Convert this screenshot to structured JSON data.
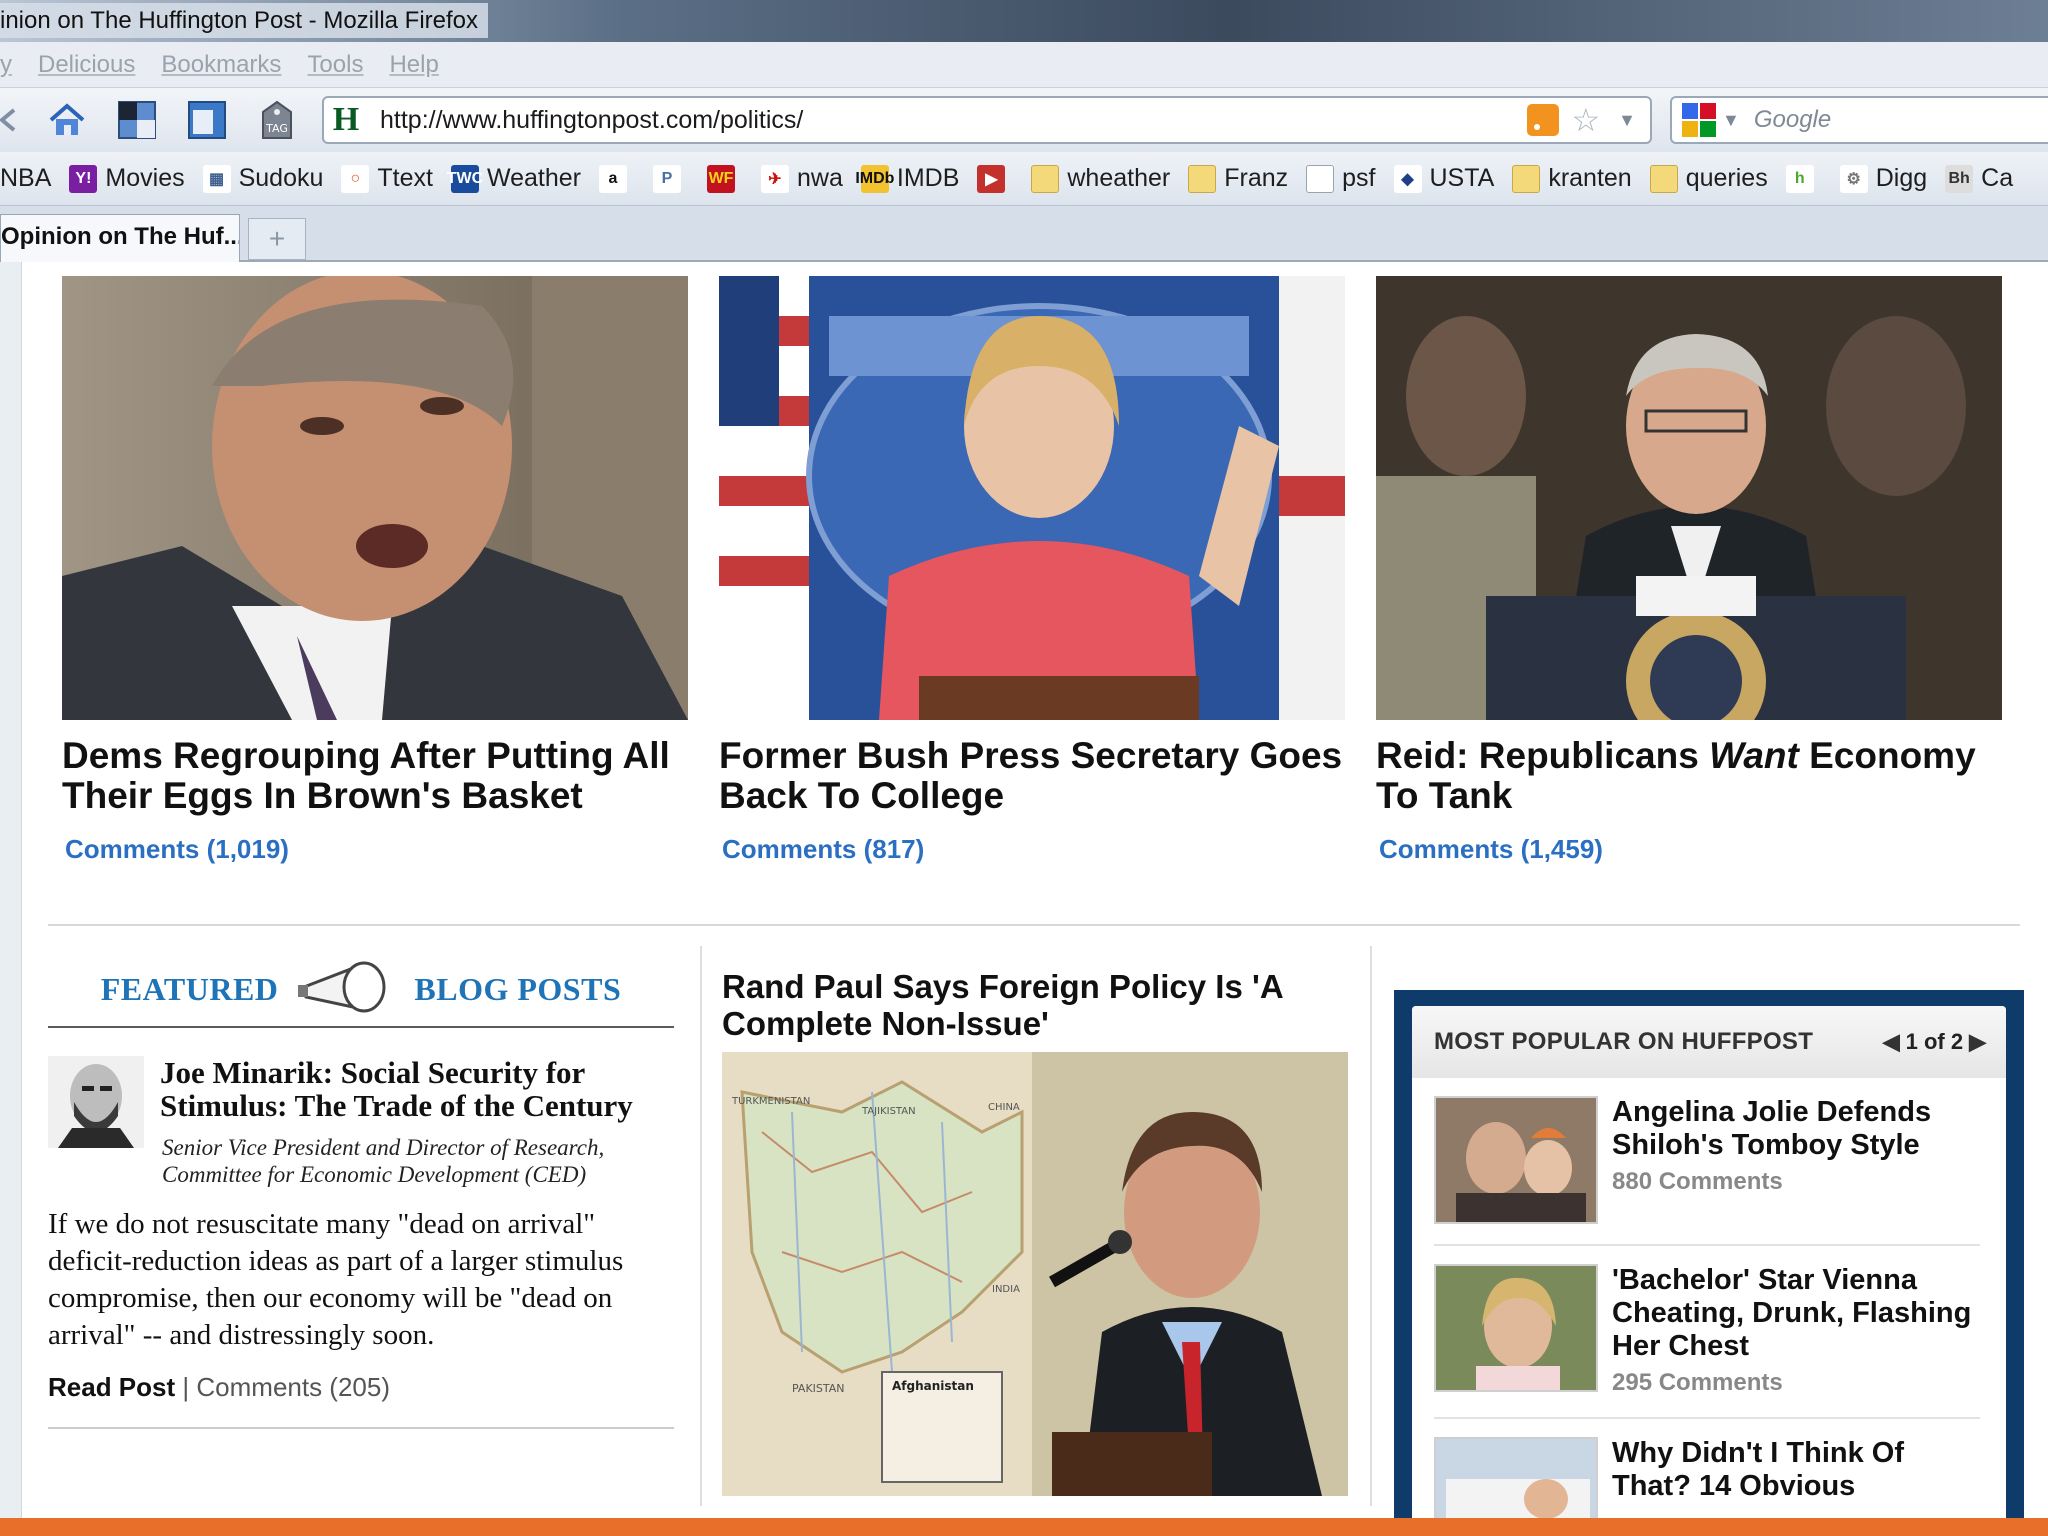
{
  "window": {
    "title": "inion on The Huffington Post - Mozilla Firefox"
  },
  "menu": [
    "y",
    "Delicious",
    "Bookmarks",
    "Tools",
    "Help"
  ],
  "nav": {
    "url": "http://www.huffingtonpost.com/politics/",
    "site_icon": "H",
    "search_placeholder": "Google",
    "icons": [
      "back-arrow-icon",
      "home-icon",
      "screen-icon",
      "window-icon",
      "tag-icon"
    ]
  },
  "bookmarks": [
    {
      "label": "NBA",
      "icon": "nba-icon"
    },
    {
      "label": "Movies",
      "icon": "yahoo-icon",
      "glyph": "Y!"
    },
    {
      "label": "Sudoku",
      "icon": "grid-icon",
      "glyph": "▦"
    },
    {
      "label": "Ttext",
      "icon": "circle-icon",
      "glyph": "○"
    },
    {
      "label": "Weather",
      "icon": "twc-icon",
      "glyph": "TWC"
    },
    {
      "label": "",
      "icon": "amazon-icon",
      "glyph": "a"
    },
    {
      "label": "",
      "icon": "p-icon",
      "glyph": "P"
    },
    {
      "label": "",
      "icon": "wf-icon",
      "glyph": "WF"
    },
    {
      "label": "nwa",
      "icon": "nwa-icon",
      "glyph": "✈"
    },
    {
      "label": "IMDB",
      "icon": "imdb-icon",
      "glyph": "IMDb"
    },
    {
      "label": "",
      "icon": "youtube-icon",
      "glyph": "▶"
    },
    {
      "label": "wheather",
      "icon": "folder-icon"
    },
    {
      "label": "Franz",
      "icon": "folder-icon"
    },
    {
      "label": "psf",
      "icon": "page-icon"
    },
    {
      "label": "USTA",
      "icon": "usta-icon",
      "glyph": "◆"
    },
    {
      "label": "kranten",
      "icon": "folder-icon"
    },
    {
      "label": "queries",
      "icon": "folder-icon"
    },
    {
      "label": "",
      "icon": "h-icon",
      "glyph": "h"
    },
    {
      "label": "Digg",
      "icon": "digg-icon",
      "glyph": "⚙"
    },
    {
      "label": "Ca",
      "icon": "bh-icon",
      "glyph": "Bh"
    }
  ],
  "tabs": [
    {
      "label": "Opinion on The Huf...",
      "active": true
    }
  ],
  "new_tab_label": "+",
  "top_stories": [
    {
      "headline": "Dems Regrouping After Putting All Their Eggs In Brown's Basket",
      "comments": "Comments (1,019)"
    },
    {
      "headline_pre": "Former Bush Press Secretary Goes Back To College",
      "comments": "Comments (817)"
    },
    {
      "headline_pre": "Reid: Republicans ",
      "headline_em": "Want",
      "headline_post": " Economy To Tank",
      "comments": "Comments (1,459)"
    }
  ],
  "featured": {
    "label_left": "FEATURED",
    "label_right": "BLOG POSTS",
    "post": {
      "title": "Joe Minarik: Social Security for Stimulus: The Trade of the Century",
      "role": "Senior Vice President and Director of Research, Committee for Economic Development (CED)",
      "excerpt": "If we do not resuscitate many \"dead on arrival\" deficit-reduction ideas as part of a larger stimulus compromise, then our economy will be \"dead on arrival\" -- and distressingly soon.",
      "read_post": "Read Post",
      "separator": "|",
      "comments": "Comments (205)"
    }
  },
  "middle_story": {
    "title": "Rand Paul Says Foreign Policy Is 'A Complete Non-Issue'",
    "map_label": "Afghanistan",
    "map_country_labels": [
      "TURKMENISTAN",
      "TAJIKISTAN",
      "CHINA",
      "PAKISTAN",
      "INDIA"
    ]
  },
  "most_popular": {
    "title": "MOST POPULAR ON HUFFPOST",
    "pager": "1 of 2",
    "items": [
      {
        "title": "Angelina Jolie Defends Shiloh's Tomboy Style",
        "count": "880 Comments"
      },
      {
        "title": "'Bachelor' Star Vienna Cheating, Drunk, Flashing Her Chest",
        "count": "295 Comments"
      },
      {
        "title": "Why Didn't I Think Of That? 14 Obvious",
        "count": ""
      }
    ]
  },
  "colors": {
    "link_blue": "#2b6fc2",
    "featured_blue": "#1f73b7",
    "popular_frame": "#0f3b6b",
    "bottom_bar": "#e86f2a"
  }
}
